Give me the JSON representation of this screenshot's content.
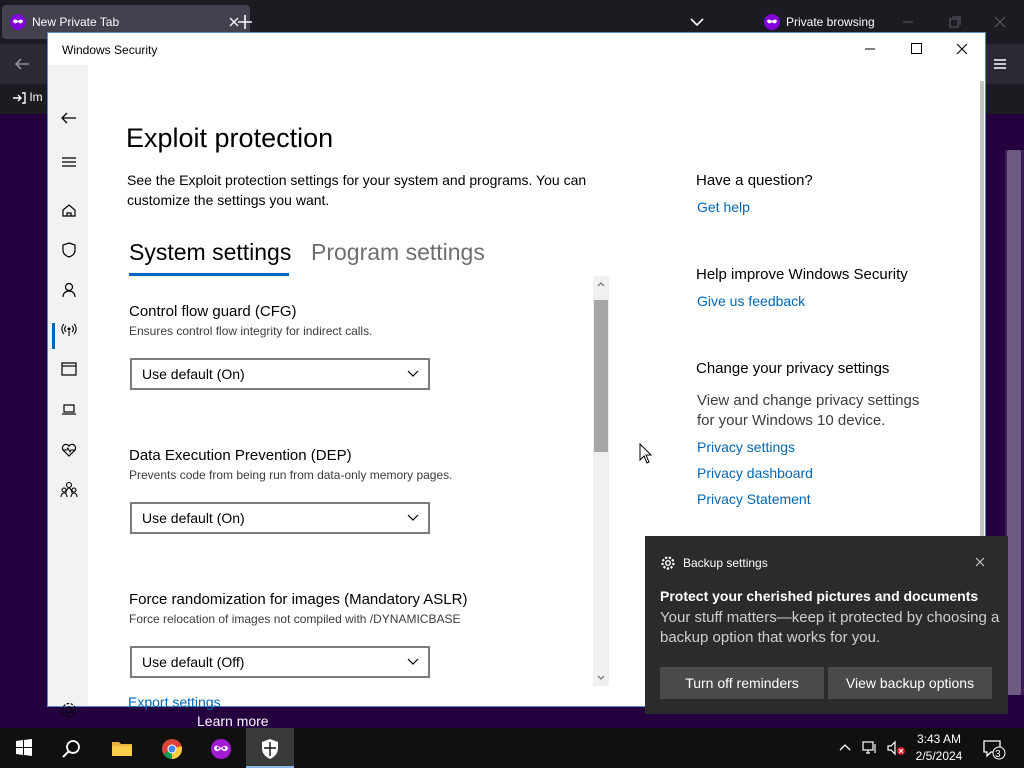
{
  "browser": {
    "tab_title": "New Private Tab",
    "private_label": "Private browsing",
    "import_label": "Im",
    "learn_more": "Learn more"
  },
  "window": {
    "title": "Windows Security"
  },
  "page": {
    "title": "Exploit protection",
    "description": "See the Exploit protection settings for your system and programs.  You can customize the settings you want.",
    "tabs": [
      {
        "label": "System settings",
        "selected": true
      },
      {
        "label": "Program settings",
        "selected": false
      }
    ],
    "settings": [
      {
        "title": "Control flow guard (CFG)",
        "description": "Ensures control flow integrity for indirect calls.",
        "value": "Use default (On)"
      },
      {
        "title": "Data Execution Prevention (DEP)",
        "description": "Prevents code from being run from data-only memory pages.",
        "value": "Use default (On)"
      },
      {
        "title": "Force randomization for images (Mandatory ASLR)",
        "description": "Force relocation of images not compiled with /DYNAMICBASE",
        "value": "Use default (Off)"
      }
    ],
    "export_label": "Export settings"
  },
  "sidebar": {
    "question_heading": "Have a question?",
    "get_help": "Get help",
    "improve_heading": "Help improve Windows Security",
    "feedback": "Give us feedback",
    "privacy_heading": "Change your privacy settings",
    "privacy_desc": "View and change privacy settings for your Windows 10 device.",
    "privacy_settings": "Privacy settings",
    "privacy_dashboard": "Privacy dashboard",
    "privacy_statement": "Privacy Statement"
  },
  "toast": {
    "app": "Backup settings",
    "title": "Protect your cherished pictures and documents",
    "body": "Your stuff matters—keep it protected by choosing a backup option that works for you.",
    "btn_off": "Turn off reminders",
    "btn_view": "View backup options"
  },
  "taskbar": {
    "time": "3:43 AM",
    "date": "2/5/2024",
    "notifications": "3"
  },
  "colors": {
    "accent": "#0067c0",
    "link": "#0067b8",
    "private_purple": "#25003e"
  }
}
